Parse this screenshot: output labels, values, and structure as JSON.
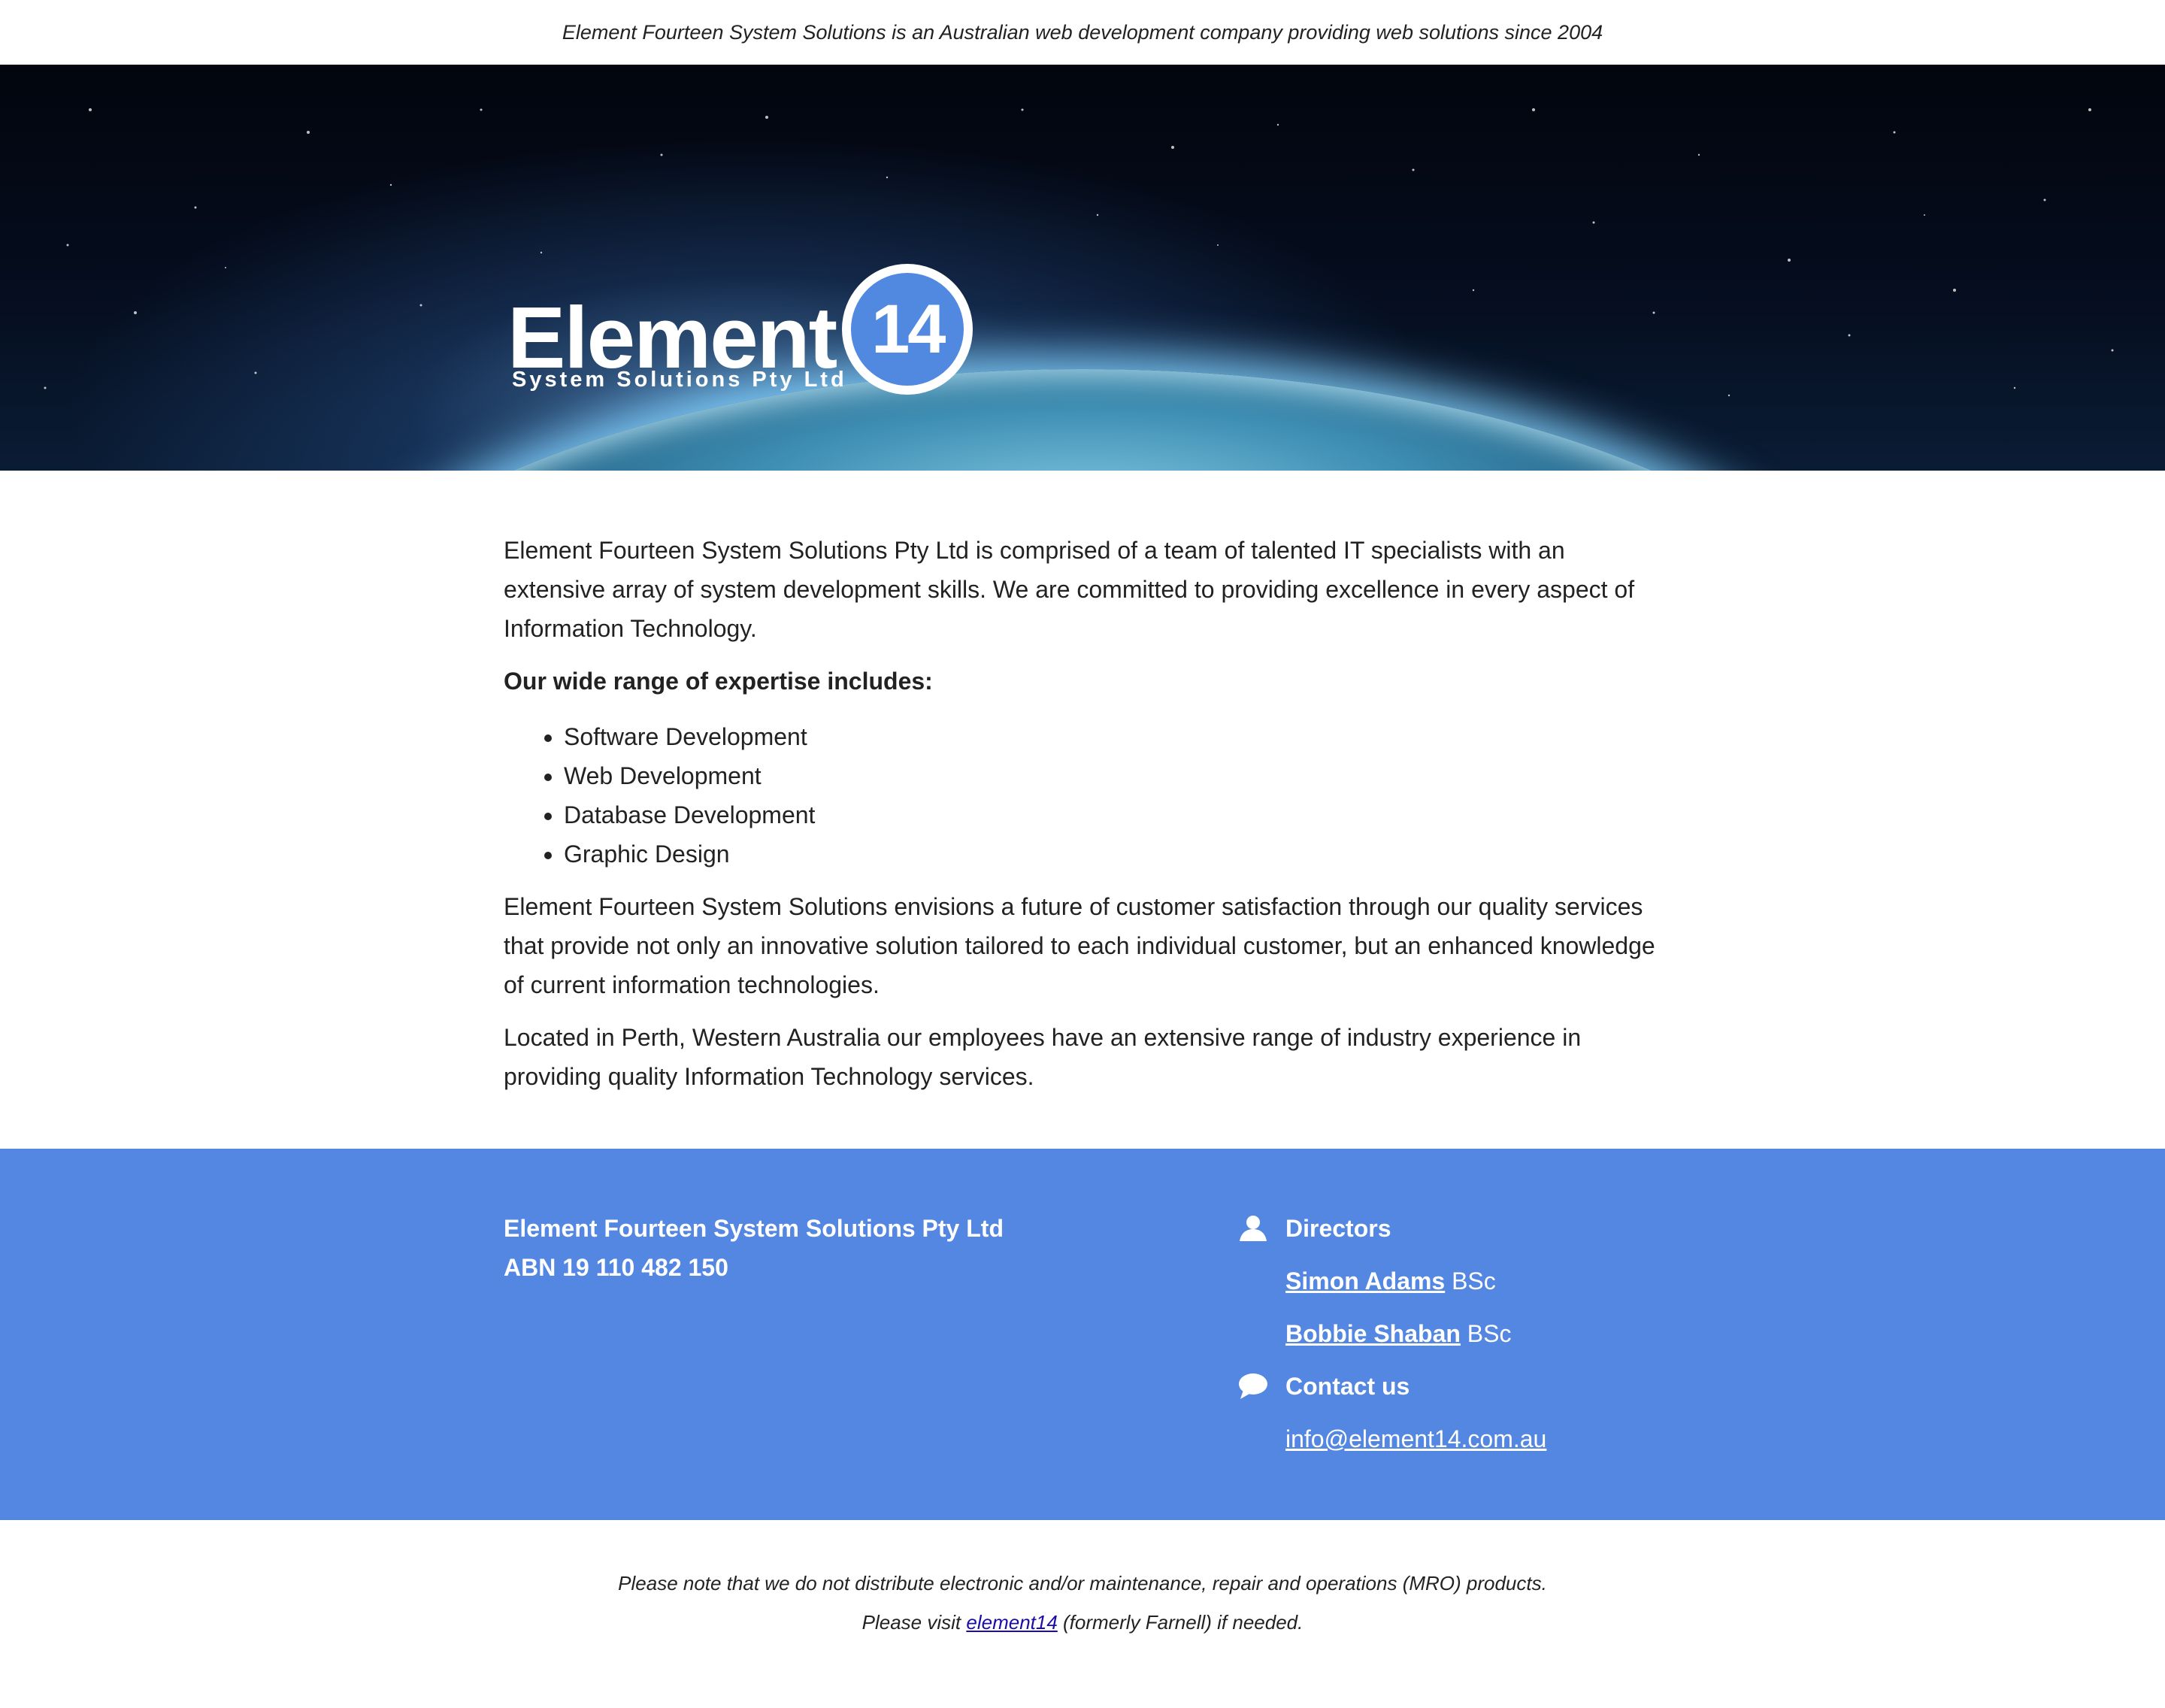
{
  "tagline": "Element Fourteen System Solutions is an Australian web development company providing web solutions since 2004",
  "logo": {
    "word": "Element",
    "badge": "14",
    "subtitle": "System Solutions Pty Ltd"
  },
  "intro": "Element Fourteen System Solutions Pty Ltd is comprised of a team of talented IT specialists with an extensive array of system development skills. We are committed to providing excellence in every aspect of Information Technology.",
  "expertise": {
    "heading": "Our wide range of expertise includes:",
    "items": [
      "Software Development",
      "Web Development",
      "Database Development",
      "Graphic Design"
    ]
  },
  "vision": "Element Fourteen System Solutions envisions a future of customer satisfaction through our quality services that provide not only an innovative solution tailored to each individual customer, but an enhanced knowledge of current information technologies.",
  "location": "Located in Perth, Western Australia our employees have an extensive range of industry experience in providing quality Information Technology services.",
  "footer": {
    "company_name": "Element Fourteen System Solutions Pty Ltd",
    "abn": "ABN 19 110 482 150",
    "directors_heading": "Directors",
    "directors": [
      {
        "name": "Simon Adams",
        "suffix": " BSc"
      },
      {
        "name": "Bobbie Shaban",
        "suffix": " BSc"
      }
    ],
    "contact_heading": "Contact us",
    "email": "info@element14.com.au"
  },
  "note": {
    "line1": "Please note that we do not distribute electronic and/or maintenance, repair and operations (MRO) products.",
    "line2_prefix": "Please visit ",
    "line2_link": "element14",
    "line2_suffix": " (formerly Farnell) if needed."
  },
  "colors": {
    "footer_blue": "#5487e1",
    "badge_blue": "#5289e0",
    "link_blue": "#1a0dab"
  },
  "icons": [
    "user-icon",
    "speech-bubble-icon"
  ]
}
